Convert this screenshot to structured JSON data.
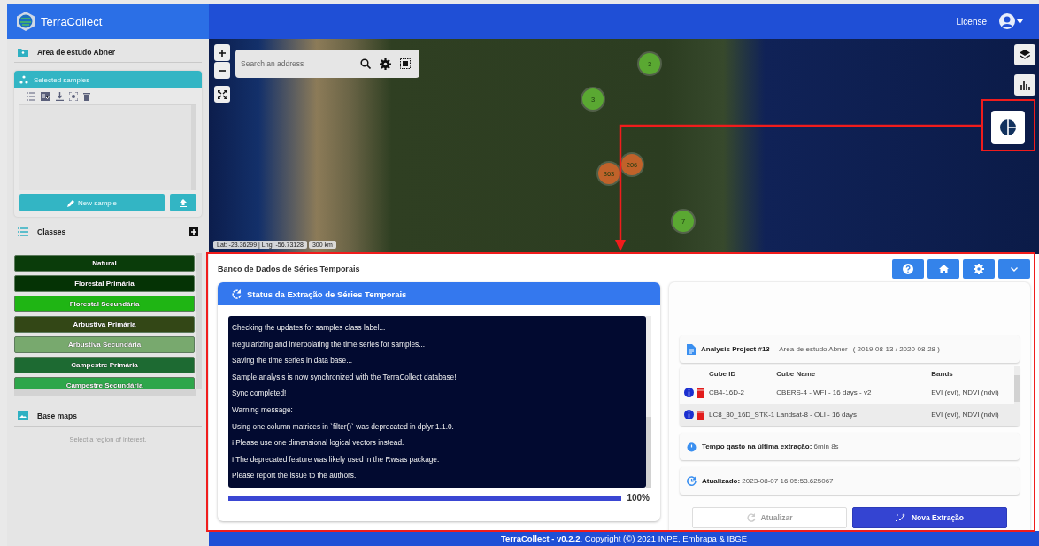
{
  "app": {
    "title": "TerraCollect",
    "license_link": "License"
  },
  "sidebar": {
    "project": {
      "title": "Area de estudo Abner"
    },
    "samples": {
      "title": "Selected samples",
      "new_sample_button": "New sample"
    },
    "classes": {
      "title": "Classes",
      "items": [
        {
          "label": "Natural",
          "color": "#0a3c0a"
        },
        {
          "label": "Florestal Primária",
          "color": "#053305"
        },
        {
          "label": "Florestal Secundária",
          "color": "#1fb514"
        },
        {
          "label": "Arbustiva Primária",
          "color": "#334716"
        },
        {
          "label": "Arbustiva Secundária",
          "color": "#78a96e"
        },
        {
          "label": "Campestre Primária",
          "color": "#1d6a32"
        },
        {
          "label": "Campestre Secundária",
          "color": "#2ea64b"
        }
      ]
    },
    "base_maps": {
      "title": "Base maps",
      "hint": "Select a region of interest."
    }
  },
  "map": {
    "search": {
      "placeholder": "Search an address"
    },
    "clusters": [
      {
        "count": "3",
        "color": "#5aa832"
      },
      {
        "count": "3",
        "color": "#5aa832"
      },
      {
        "count": "363",
        "color": "#c0622a"
      },
      {
        "count": "206",
        "color": "#c0622a"
      },
      {
        "count": "7",
        "color": "#5aa832"
      }
    ],
    "coordinates": "Lat: -23.36299 | Lng: -56.73128",
    "scale": "300 km"
  },
  "panel": {
    "title": "Banco de Dados de Séries Temporais",
    "status": {
      "title": "Status da Extração de Séries Temporais",
      "log_lines": [
        "Checking the updates for samples class label...",
        "Regularizing and interpolating the time series for samples...",
        "Saving the time series in data base...",
        "Sample analysis is now synchronized with the TerraCollect database!",
        "Sync completed!",
        "Warning message:",
        "Using one column matrices in `filter()` was deprecated in dplyr 1.1.0.",
        "ℹ Please use one dimensional logical vectors instead.",
        "ℹ The deprecated feature was likely used in the Rwsas package.",
        "Please report the issue to the authors."
      ],
      "progress": {
        "level": 1,
        "reading": "100%"
      }
    },
    "project": {
      "label": "Analysis Project #13",
      "area": "- Area de estudo Abner",
      "period": "( 2019-08-13 / 2020-08-28 )"
    },
    "cubes": {
      "columns": [
        "Cube ID",
        "Cube Name",
        "Bands"
      ],
      "rows": [
        {
          "cube_id": "CB4-16D-2",
          "cube_name": "CBERS-4 - WFI - 16 days - v2",
          "bands": "EVI (evi), NDVI (ndvi)",
          "selected": false
        },
        {
          "cube_id": "LC8_30_16D_STK-1",
          "cube_name": "Landsat-8 - OLI - 16 days",
          "bands": "EVI (evi), NDVI (ndvi)",
          "selected": true
        }
      ]
    },
    "elapsed": {
      "label": "Tempo gasto na última extração:",
      "value": "6min 8s"
    },
    "updated": {
      "label": "Atualizado:",
      "value": "2023-08-07 16:05:53.625067"
    },
    "buttons": [
      {
        "kind": "refresh",
        "label": "Atualizar",
        "disabled": true
      },
      {
        "kind": "extract",
        "label": "Nova Extração",
        "disabled": false
      }
    ]
  },
  "footer": "**TerraCollect - v0.2.2**, Copyright (©) 2021 INPE, Embrapa & IBGE"
}
